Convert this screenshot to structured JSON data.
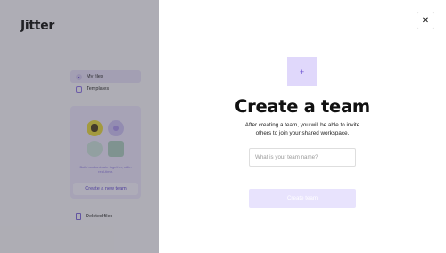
{
  "app": {
    "logo": "Jitter",
    "nav": [
      {
        "label": "My files",
        "icon": "user-circle-icon"
      },
      {
        "label": "Templates",
        "icon": "template-icon"
      }
    ],
    "team_card": {
      "text": "Build and animate together, all in real-time.",
      "button_label": "Create a new team"
    },
    "deleted_label": "Deleted files"
  },
  "modal": {
    "close_glyph": "✕",
    "add_glyph": "+",
    "title": "Create a team",
    "subtitle": "After creating a team, you will be able to invite others to join your shared workspace.",
    "input_placeholder": "What is your team name?",
    "input_value": "",
    "create_label": "Create team"
  },
  "colors": {
    "accent": "#6b51d1",
    "accent_light": "#e0d8fb",
    "overlay": "#3c3c46"
  }
}
